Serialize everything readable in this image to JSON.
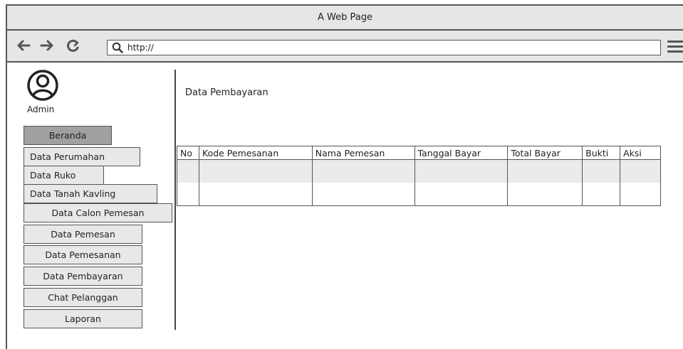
{
  "window": {
    "title": "A Web Page"
  },
  "toolbar": {
    "back_icon": "back-arrow-icon",
    "forward_icon": "forward-arrow-icon",
    "reload_icon": "reload-icon",
    "url": "http://",
    "menu_icon": "hamburger-menu-icon"
  },
  "sidebar": {
    "user_label": "Admin",
    "items": [
      {
        "label": "Beranda",
        "active": true
      },
      {
        "label": "Data Perumahan"
      },
      {
        "label": "Data Ruko"
      },
      {
        "label": "Data Tanah Kavling"
      },
      {
        "label": "Data Calon Pemesan"
      },
      {
        "label": "Data Pemesan"
      },
      {
        "label": "Data Pemesanan"
      },
      {
        "label": "Data Pembayaran"
      },
      {
        "label": "Chat Pelanggan"
      },
      {
        "label": "Laporan"
      }
    ]
  },
  "main": {
    "title": "Data Pembayaran",
    "table": {
      "columns": [
        "No",
        "Kode Pemesanan",
        "Nama Pemesan",
        "Tanggal Bayar",
        "Total Bayar",
        "Bukti",
        "Aksi"
      ],
      "rows": [
        [
          "",
          "",
          "",
          "",
          "",
          "",
          ""
        ],
        [
          "",
          "",
          "",
          "",
          "",
          "",
          ""
        ]
      ]
    }
  }
}
